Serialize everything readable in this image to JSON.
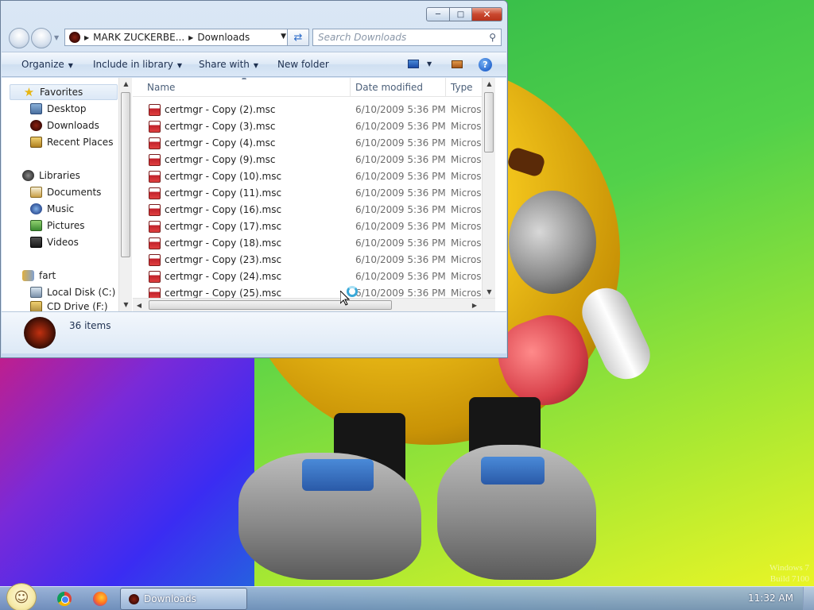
{
  "window": {
    "caption_buttons": {
      "minimize_icon": "minimize-icon",
      "maximize_icon": "maximize-icon",
      "close_icon": "close-icon"
    }
  },
  "address_bar": {
    "crumbs": [
      "MARK ZUCKERBE...",
      "Downloads"
    ],
    "search_placeholder": "Search Downloads"
  },
  "toolbar": {
    "organize": "Organize",
    "include_in_library": "Include in library",
    "share_with": "Share with",
    "new_folder": "New folder",
    "help": "?"
  },
  "nav_pane": {
    "groups": [
      {
        "label": "Favorites",
        "icon": "star-icon",
        "items": [
          {
            "label": "Desktop",
            "icon": "desktop-icon"
          },
          {
            "label": "Downloads",
            "icon": "downloads-icon"
          },
          {
            "label": "Recent Places",
            "icon": "recent-places-icon"
          }
        ]
      },
      {
        "label": "Libraries",
        "icon": "libraries-icon",
        "items": [
          {
            "label": "Documents",
            "icon": "documents-icon"
          },
          {
            "label": "Music",
            "icon": "music-icon"
          },
          {
            "label": "Pictures",
            "icon": "pictures-icon"
          },
          {
            "label": "Videos",
            "icon": "videos-icon"
          }
        ]
      },
      {
        "label": "fart",
        "icon": "homegroup-icon",
        "items": [
          {
            "label": "Local Disk (C:)",
            "icon": "disk-icon"
          },
          {
            "label": "CD Drive (F:)",
            "icon": "cd-drive-icon"
          }
        ]
      }
    ]
  },
  "file_list": {
    "columns": {
      "name": "Name",
      "date": "Date modified",
      "type": "Type"
    },
    "rows": [
      {
        "name": "certmgr - Copy (2).msc",
        "date": "6/10/2009 5:36 PM",
        "type": "Microsoft"
      },
      {
        "name": "certmgr - Copy (3).msc",
        "date": "6/10/2009 5:36 PM",
        "type": "Microsoft"
      },
      {
        "name": "certmgr - Copy (4).msc",
        "date": "6/10/2009 5:36 PM",
        "type": "Microsoft"
      },
      {
        "name": "certmgr - Copy (9).msc",
        "date": "6/10/2009 5:36 PM",
        "type": "Microsoft"
      },
      {
        "name": "certmgr - Copy (10).msc",
        "date": "6/10/2009 5:36 PM",
        "type": "Microsoft"
      },
      {
        "name": "certmgr - Copy (11).msc",
        "date": "6/10/2009 5:36 PM",
        "type": "Microsoft"
      },
      {
        "name": "certmgr - Copy (16).msc",
        "date": "6/10/2009 5:36 PM",
        "type": "Microsoft"
      },
      {
        "name": "certmgr - Copy (17).msc",
        "date": "6/10/2009 5:36 PM",
        "type": "Microsoft"
      },
      {
        "name": "certmgr - Copy (18).msc",
        "date": "6/10/2009 5:36 PM",
        "type": "Microsoft"
      },
      {
        "name": "certmgr - Copy (23).msc",
        "date": "6/10/2009 5:36 PM",
        "type": "Microsoft"
      },
      {
        "name": "certmgr - Copy (24).msc",
        "date": "6/10/2009 5:36 PM",
        "type": "Microsoft"
      },
      {
        "name": "certmgr - Copy (25).msc",
        "date": "6/10/2009 5:36 PM",
        "type": "Microsoft"
      }
    ]
  },
  "details_pane": {
    "item_count": "36 items"
  },
  "taskbar": {
    "window_button": "Downloads",
    "clock": "11:32 AM"
  },
  "watermark": {
    "line1": "Windows 7",
    "line2": "Build 7100"
  }
}
